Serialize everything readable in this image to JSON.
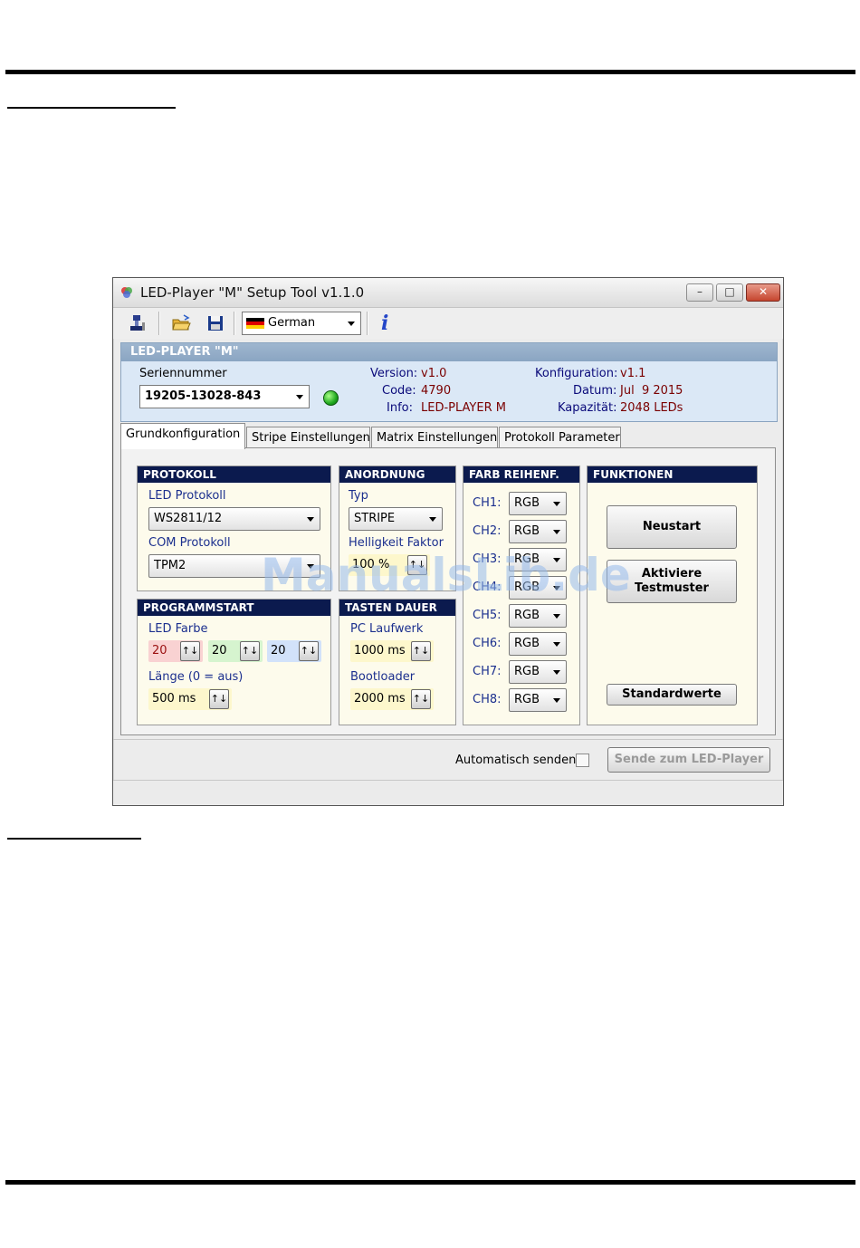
{
  "window": {
    "title": "LED-Player \"M\" Setup Tool v1.1.0",
    "minimize": "–",
    "maximize": "□",
    "close": "✕"
  },
  "toolbar": {
    "language": "German",
    "icons": [
      "connect-icon",
      "open-folder-icon",
      "save-icon",
      "info-icon"
    ],
    "info_glyph": "i"
  },
  "header": {
    "title": "LED-PLAYER \"M\"",
    "serial_label": "Seriennummer",
    "serial_value": "19205-13028-843",
    "status_color": "#1fa81f",
    "version_label": "Version:",
    "version_value": "v1.0",
    "code_label": "Code:",
    "code_value": "4790",
    "info_label": "Info:",
    "info_value": "LED-PLAYER M",
    "config_label": "Konfiguration:",
    "config_value": "v1.1",
    "date_label": "Datum:",
    "date_value": "Jul  9 2015",
    "capacity_label": "Kapazität:",
    "capacity_value": "2048 LEDs"
  },
  "tabs": [
    "Grundkonfiguration",
    "Stripe Einstellungen",
    "Matrix Einstellungen",
    "Protokoll Parameter"
  ],
  "protokoll": {
    "title": "PROTOKOLL",
    "led_label": "LED Protokoll",
    "led_value": "WS2811/12",
    "com_label": "COM Protokoll",
    "com_value": "TPM2"
  },
  "anordnung": {
    "title": "ANORDNUNG",
    "typ_label": "Typ",
    "typ_value": "STRIPE",
    "helligkeit_label": "Helligkeit Faktor",
    "helligkeit_value": "100 %"
  },
  "programmstart": {
    "title": "PROGRAMMSTART",
    "farbe_label": "LED Farbe",
    "red": "20",
    "green": "20",
    "blue": "20",
    "laenge_label": "Länge (0 = aus)",
    "laenge_value": "500 ms"
  },
  "tasten": {
    "title": "TASTEN DAUER",
    "pc_label": "PC Laufwerk",
    "pc_value": "1000 ms",
    "boot_label": "Bootloader",
    "boot_value": "2000 ms"
  },
  "farb": {
    "title": "FARB REIHENF.",
    "channels": [
      {
        "label": "CH1:",
        "value": "RGB"
      },
      {
        "label": "CH2:",
        "value": "RGB"
      },
      {
        "label": "CH3:",
        "value": "RGB"
      },
      {
        "label": "CH4:",
        "value": "RGB"
      },
      {
        "label": "CH5:",
        "value": "RGB"
      },
      {
        "label": "CH6:",
        "value": "RGB"
      },
      {
        "label": "CH7:",
        "value": "RGB"
      },
      {
        "label": "CH8:",
        "value": "RGB"
      }
    ]
  },
  "funktionen": {
    "title": "FUNKTIONEN",
    "neustart": "Neustart",
    "testmuster_line1": "Aktiviere",
    "testmuster_line2": "Testmuster",
    "standard": "Standardwerte"
  },
  "footer": {
    "auto_label": "Automatisch senden",
    "send_button": "Sende zum LED-Player"
  },
  "watermark": "ManualsLib.de"
}
